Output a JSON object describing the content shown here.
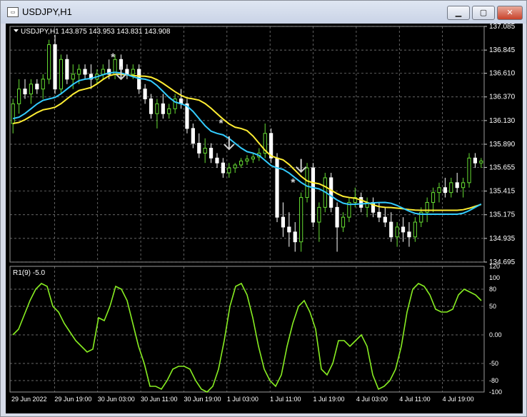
{
  "window": {
    "title": "USDJPY,H1",
    "icon": "chart-window-icon",
    "controls": {
      "minimize": "minimize-icon",
      "maximize": "maximize-icon",
      "close": "close-icon"
    }
  },
  "colors": {
    "background": "#000000",
    "grid": "#8a8a8a",
    "bull": "#66dd33",
    "bear": "#ffffff",
    "ma_fast": "#33ccff",
    "ma_slow": "#ffee33",
    "oscillator": "#88ee22",
    "arrow": "#cfcfcf",
    "star": "#cfcfcf"
  },
  "main_header": {
    "symbol_info": "USDJPY,H1",
    "ohlc": "143.875 143.953 143.831 143.908"
  },
  "sub_header": "R1(9) -5.0",
  "time_labels": [
    "29 Jun 2022",
    "29 Jun 19:00",
    "30 Jun 03:00",
    "30 Jun 11:00",
    "30 Jun 19:00",
    "1 Jul 03:00",
    "1 Jul 11:00",
    "1 Jul 19:00",
    "4 Jul 03:00",
    "4 Jul 11:00",
    "4 Jul 19:00"
  ],
  "chart_data": [
    {
      "type": "candlestick",
      "y_ticks": [
        "137.085",
        "136.845",
        "136.610",
        "136.370",
        "136.130",
        "135.890",
        "135.655",
        "135.415",
        "135.175",
        "134.935",
        "134.695"
      ],
      "ylim": [
        134.695,
        137.085
      ],
      "grid": true,
      "candles": [
        [
          136.1,
          136.35,
          136.0,
          136.3
        ],
        [
          136.3,
          136.55,
          136.2,
          136.45
        ],
        [
          136.45,
          136.55,
          136.35,
          136.4
        ],
        [
          136.4,
          136.55,
          136.3,
          136.5
        ],
        [
          136.5,
          136.55,
          136.4,
          136.45
        ],
        [
          136.45,
          136.6,
          136.35,
          136.55
        ],
        [
          136.55,
          136.95,
          136.5,
          136.9
        ],
        [
          136.9,
          137.0,
          136.4,
          136.45
        ],
        [
          136.45,
          136.8,
          136.4,
          136.75
        ],
        [
          136.75,
          136.8,
          136.5,
          136.55
        ],
        [
          136.55,
          136.7,
          136.45,
          136.6
        ],
        [
          136.6,
          136.7,
          136.5,
          136.65
        ],
        [
          136.65,
          136.7,
          136.55,
          136.6
        ],
        [
          136.6,
          136.7,
          136.45,
          136.55
        ],
        [
          136.55,
          136.65,
          136.5,
          136.6
        ],
        [
          136.6,
          136.7,
          136.55,
          136.65
        ],
        [
          136.65,
          136.75,
          136.55,
          136.6
        ],
        [
          136.6,
          136.8,
          136.55,
          136.75
        ],
        [
          136.75,
          136.8,
          136.6,
          136.65
        ],
        [
          136.65,
          136.7,
          136.55,
          136.6
        ],
        [
          136.6,
          136.7,
          136.55,
          136.65
        ],
        [
          136.65,
          136.7,
          136.4,
          136.45
        ],
        [
          136.45,
          136.5,
          136.3,
          136.35
        ],
        [
          136.35,
          136.4,
          136.15,
          136.2
        ],
        [
          136.2,
          136.35,
          136.05,
          136.3
        ],
        [
          136.3,
          136.4,
          136.15,
          136.2
        ],
        [
          136.2,
          136.3,
          136.15,
          136.25
        ],
        [
          136.25,
          136.4,
          136.2,
          136.35
        ],
        [
          136.35,
          136.45,
          136.25,
          136.3
        ],
        [
          136.3,
          136.35,
          136.0,
          136.05
        ],
        [
          136.05,
          136.1,
          135.85,
          135.9
        ],
        [
          135.9,
          136.0,
          135.75,
          135.8
        ],
        [
          135.8,
          135.95,
          135.7,
          135.85
        ],
        [
          135.85,
          135.9,
          135.7,
          135.75
        ],
        [
          135.75,
          135.8,
          135.65,
          135.7
        ],
        [
          135.7,
          135.75,
          135.55,
          135.6
        ],
        [
          135.6,
          135.7,
          135.55,
          135.65
        ],
        [
          135.65,
          135.7,
          135.6,
          135.68
        ],
        [
          135.68,
          135.75,
          135.65,
          135.72
        ],
        [
          135.72,
          135.78,
          135.68,
          135.74
        ],
        [
          135.74,
          135.8,
          135.7,
          135.76
        ],
        [
          135.76,
          135.85,
          135.72,
          135.8
        ],
        [
          135.8,
          136.1,
          135.75,
          136.0
        ],
        [
          136.0,
          136.05,
          135.7,
          135.75
        ],
        [
          135.75,
          135.8,
          135.1,
          135.15
        ],
        [
          135.15,
          135.3,
          134.95,
          135.05
        ],
        [
          135.05,
          135.2,
          134.85,
          135.0
        ],
        [
          135.0,
          135.1,
          134.8,
          134.9
        ],
        [
          134.9,
          135.4,
          134.8,
          135.35
        ],
        [
          135.35,
          135.7,
          135.3,
          135.65
        ],
        [
          135.65,
          135.7,
          135.05,
          135.1
        ],
        [
          135.1,
          135.3,
          134.9,
          135.25
        ],
        [
          135.25,
          135.6,
          135.2,
          135.55
        ],
        [
          135.55,
          135.6,
          135.2,
          135.25
        ],
        [
          135.25,
          135.3,
          134.8,
          135.05
        ],
        [
          135.05,
          135.2,
          135.0,
          135.15
        ],
        [
          135.15,
          135.35,
          135.1,
          135.3
        ],
        [
          135.3,
          135.45,
          135.25,
          135.35
        ],
        [
          135.35,
          135.4,
          135.2,
          135.25
        ],
        [
          135.25,
          135.35,
          135.15,
          135.3
        ],
        [
          135.3,
          135.35,
          135.15,
          135.2
        ],
        [
          135.2,
          135.3,
          135.1,
          135.15
        ],
        [
          135.15,
          135.25,
          135.05,
          135.1
        ],
        [
          135.1,
          135.2,
          134.9,
          134.95
        ],
        [
          134.95,
          135.1,
          134.85,
          135.05
        ],
        [
          135.05,
          135.15,
          134.9,
          135.0
        ],
        [
          135.0,
          135.1,
          134.85,
          134.95
        ],
        [
          134.95,
          135.15,
          134.9,
          135.1
        ],
        [
          135.1,
          135.25,
          135.05,
          135.2
        ],
        [
          135.2,
          135.35,
          135.1,
          135.3
        ],
        [
          135.3,
          135.45,
          135.2,
          135.4
        ],
        [
          135.4,
          135.5,
          135.3,
          135.45
        ],
        [
          135.45,
          135.55,
          135.35,
          135.4
        ],
        [
          135.4,
          135.55,
          135.35,
          135.5
        ],
        [
          135.5,
          135.6,
          135.4,
          135.45
        ],
        [
          135.45,
          135.55,
          135.35,
          135.5
        ],
        [
          135.5,
          135.8,
          135.45,
          135.75
        ],
        [
          135.75,
          135.8,
          135.65,
          135.7
        ],
        [
          135.7,
          135.75,
          135.65,
          135.72
        ]
      ],
      "ma_fast_keypoints": [
        [
          0,
          136.15
        ],
        [
          6,
          136.35
        ],
        [
          12,
          136.55
        ],
        [
          17,
          136.62
        ],
        [
          22,
          136.55
        ],
        [
          28,
          136.3
        ],
        [
          34,
          136.0
        ],
        [
          40,
          135.8
        ],
        [
          44,
          135.65
        ],
        [
          50,
          135.45
        ],
        [
          56,
          135.28
        ],
        [
          62,
          135.3
        ],
        [
          68,
          135.18
        ],
        [
          74,
          135.18
        ],
        [
          80,
          135.32
        ],
        [
          88,
          135.55
        ]
      ],
      "ma_slow_keypoints": [
        [
          0,
          136.1
        ],
        [
          6,
          136.25
        ],
        [
          12,
          136.45
        ],
        [
          17,
          136.6
        ],
        [
          22,
          136.58
        ],
        [
          30,
          136.35
        ],
        [
          38,
          136.05
        ],
        [
          44,
          135.75
        ],
        [
          50,
          135.5
        ],
        [
          56,
          135.35
        ],
        [
          62,
          135.25
        ],
        [
          68,
          135.22
        ],
        [
          74,
          135.22
        ],
        [
          80,
          135.3
        ],
        [
          88,
          135.42
        ]
      ],
      "arrows_down": [
        [
          18,
          136.55
        ],
        [
          36,
          135.84
        ],
        [
          48,
          135.61
        ]
      ],
      "stars": [
        [
          17,
          136.77
        ],
        [
          35,
          136.1
        ],
        [
          47,
          135.5
        ]
      ]
    },
    {
      "type": "line",
      "title": "R1(9) -5.0",
      "y_ticks": [
        "120",
        "100",
        "80",
        "50",
        "0.00",
        "-50",
        "-80",
        "-100"
      ],
      "ylim": [
        -100,
        120
      ],
      "series": [
        {
          "values": [
            0,
            10,
            35,
            60,
            80,
            90,
            85,
            50,
            40,
            20,
            5,
            -10,
            -20,
            -30,
            -25,
            30,
            25,
            50,
            85,
            80,
            60,
            20,
            -20,
            -50,
            -90,
            -90,
            -95,
            -80,
            -60,
            -55,
            -55,
            -60,
            -80,
            -95,
            -100,
            -90,
            -60,
            -10,
            50,
            85,
            90,
            70,
            30,
            -20,
            -60,
            -80,
            -90,
            -70,
            -20,
            20,
            50,
            60,
            40,
            10,
            -60,
            -70,
            -50,
            -10,
            -10,
            -20,
            -10,
            0,
            -20,
            -70,
            -95,
            -90,
            -80,
            -60,
            -20,
            40,
            80,
            90,
            85,
            70,
            45,
            40,
            40,
            45,
            70,
            80,
            75,
            70,
            60
          ]
        }
      ]
    }
  ]
}
